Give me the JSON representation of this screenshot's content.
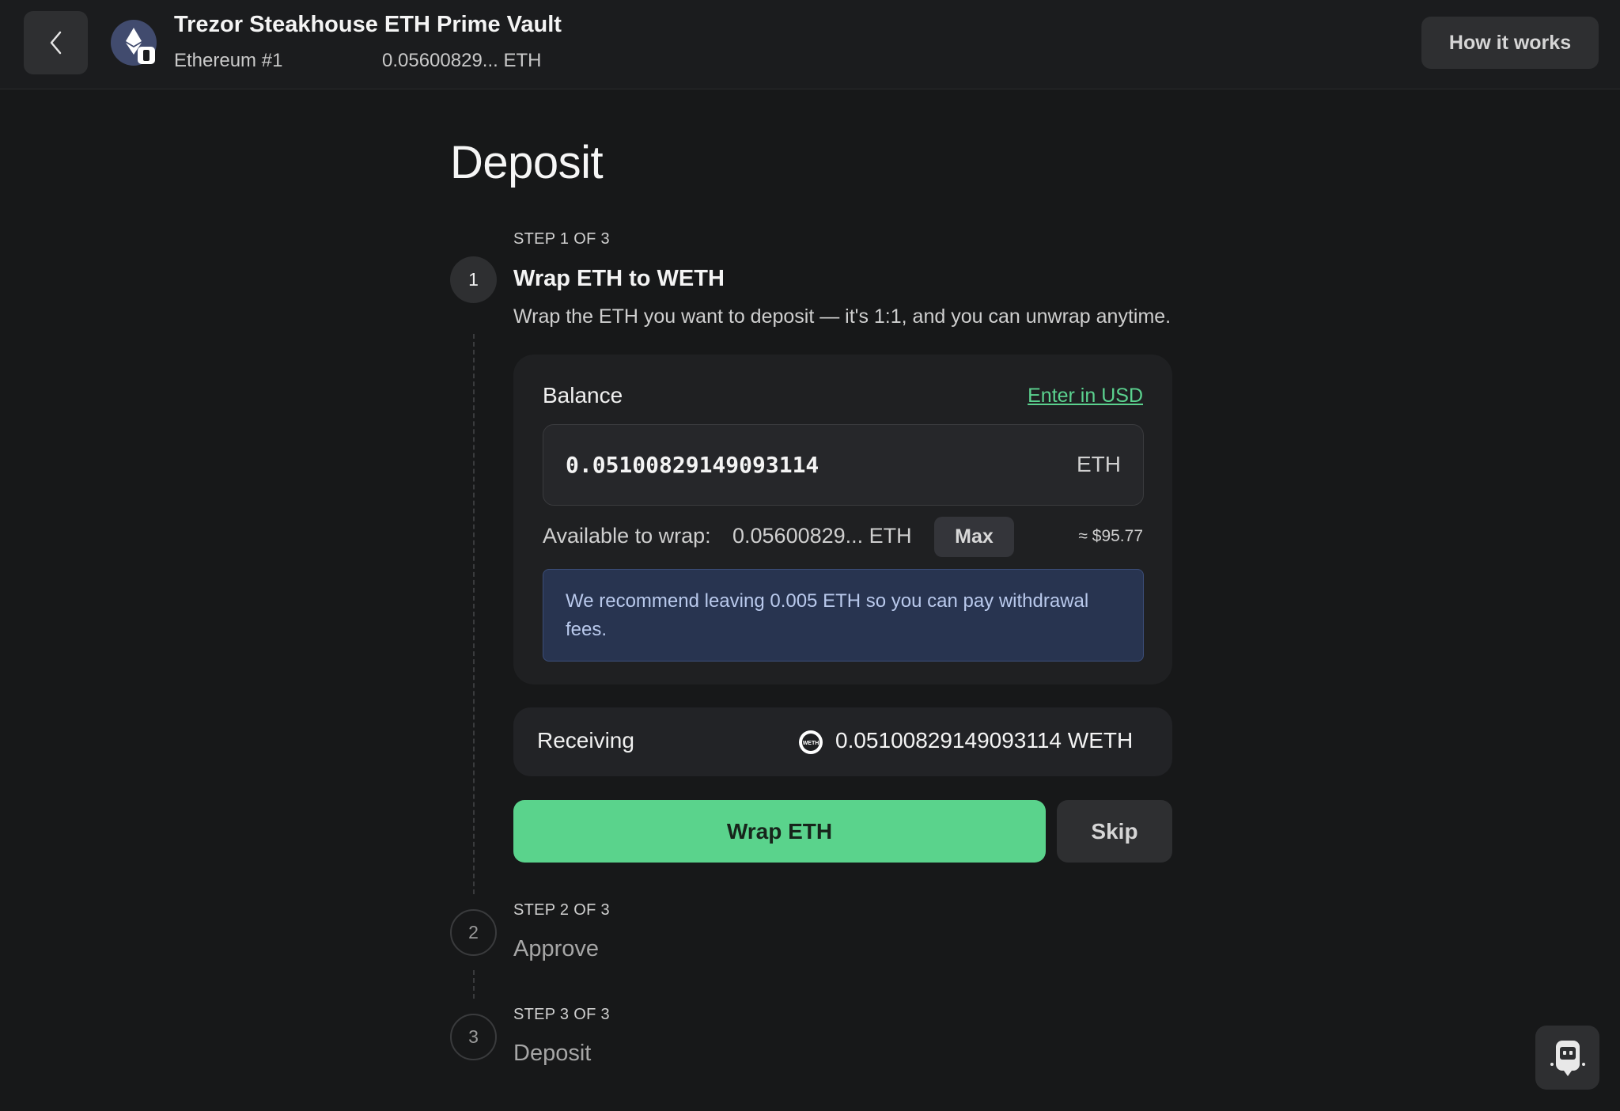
{
  "header": {
    "vault_title": "Trezor Steakhouse ETH Prime Vault",
    "network": "Ethereum #1",
    "balance": "0.05600829... ETH",
    "how_it_works": "How it works"
  },
  "page": {
    "title": "Deposit"
  },
  "steps": [
    {
      "label": "STEP 1 OF 3",
      "number": "1",
      "title": "Wrap ETH to WETH",
      "description": "Wrap the ETH you want to deposit — it's 1:1, and you can unwrap anytime.",
      "status": "active"
    },
    {
      "label": "STEP 2 OF 3",
      "number": "2",
      "title": "Approve",
      "status": "pending"
    },
    {
      "label": "STEP 3 OF 3",
      "number": "3",
      "title": "Deposit",
      "status": "pending"
    }
  ],
  "wrap_form": {
    "balance_label": "Balance",
    "usd_toggle": "Enter in USD",
    "amount": "0.05100829149093114",
    "unit": "ETH",
    "available_label": "Available to wrap:",
    "available_value": "0.05600829... ETH",
    "max_label": "Max",
    "usd_approx": "≈ $95.77",
    "notice": "We recommend leaving 0.005 ETH so you can pay withdrawal fees."
  },
  "receiving": {
    "label": "Receiving",
    "token_icon": "weth-icon",
    "token_icon_text": "WETH",
    "value": "0.05100829149093114 WETH"
  },
  "actions": {
    "primary": "Wrap ETH",
    "secondary": "Skip"
  },
  "colors": {
    "accent_green": "#5ad38c",
    "link_green": "#5bd28f",
    "notice_bg": "#283450",
    "background": "#171819"
  }
}
